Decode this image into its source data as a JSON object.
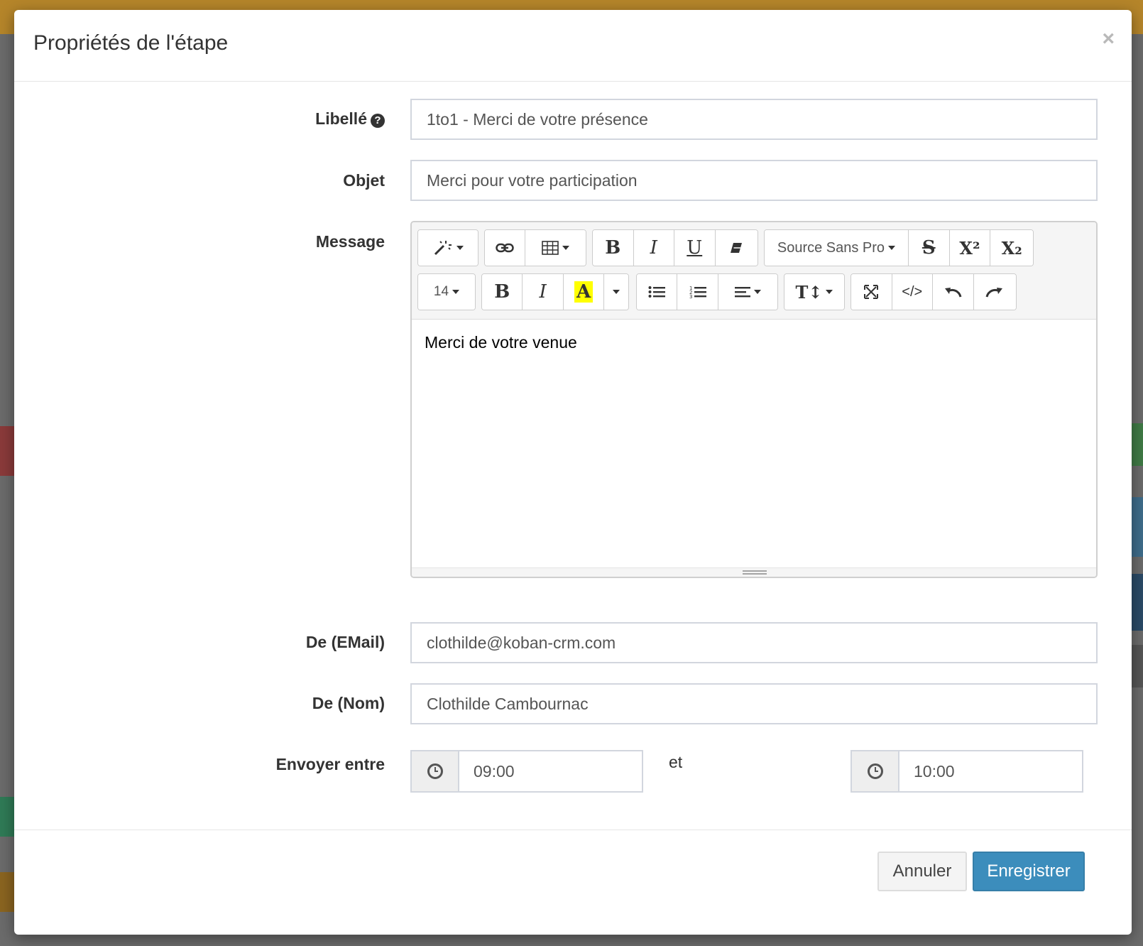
{
  "modal": {
    "title": "Propriétés de l'étape",
    "close_label": "×"
  },
  "form": {
    "libelle": {
      "label": "Libellé",
      "value": "1to1 - Merci de votre présence"
    },
    "objet": {
      "label": "Objet",
      "value": "Merci pour votre participation"
    },
    "message": {
      "label": "Message",
      "content": "Merci de votre venue"
    },
    "from_email": {
      "label": "De (EMail)",
      "value": "clothilde@koban-crm.com"
    },
    "from_name": {
      "label": "De (Nom)",
      "value": "Clothilde Cambournac"
    },
    "send_between": {
      "label": "Envoyer entre",
      "start": "09:00",
      "and": "et",
      "end": "10:00"
    }
  },
  "toolbar": {
    "font_family": "Source Sans Pro",
    "font_size": "14",
    "bold": "B",
    "italic": "I",
    "underline": "U",
    "strike": "S",
    "superscript": "X²",
    "subscript": "X₂",
    "highlight": "A",
    "highlight_color": "#ffff00",
    "line_height": "T↕",
    "code_view": "</>"
  },
  "footer": {
    "cancel_label": "Annuler",
    "save_label": "Enregistrer"
  },
  "colors": {
    "primary": "#3c8dbc",
    "topbar": "#b5852a"
  }
}
